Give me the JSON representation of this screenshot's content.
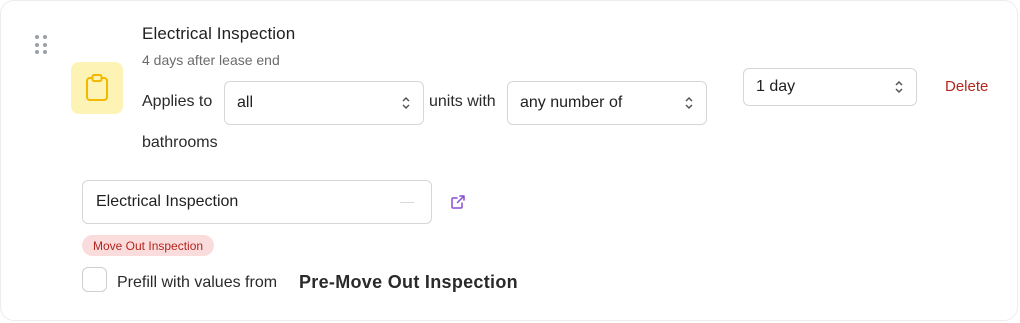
{
  "task": {
    "title": "Electrical Inspection",
    "timing": "4 days after lease end",
    "icon": "clipboard-icon",
    "icon_color": "#f5b800"
  },
  "rule": {
    "applies_to_label": "Applies to",
    "units_selector_value": "all",
    "units_with_label": "units with",
    "count_selector_value": "any number of",
    "trailing_label": "bathrooms"
  },
  "duration": {
    "value": "1 day"
  },
  "actions": {
    "delete_label": "Delete"
  },
  "template": {
    "value": "Electrical Inspection",
    "open_icon": "external-link-icon",
    "badge": "Move Out Inspection"
  },
  "prefill": {
    "label": "Prefill with values from",
    "source": "Pre-Move Out Inspection",
    "checked": false
  },
  "colors": {
    "danger": "#b3261e",
    "badge_bg": "#fbdcdc",
    "icon_bg": "#fdf3b5",
    "link_accent": "#8a4dd6"
  }
}
